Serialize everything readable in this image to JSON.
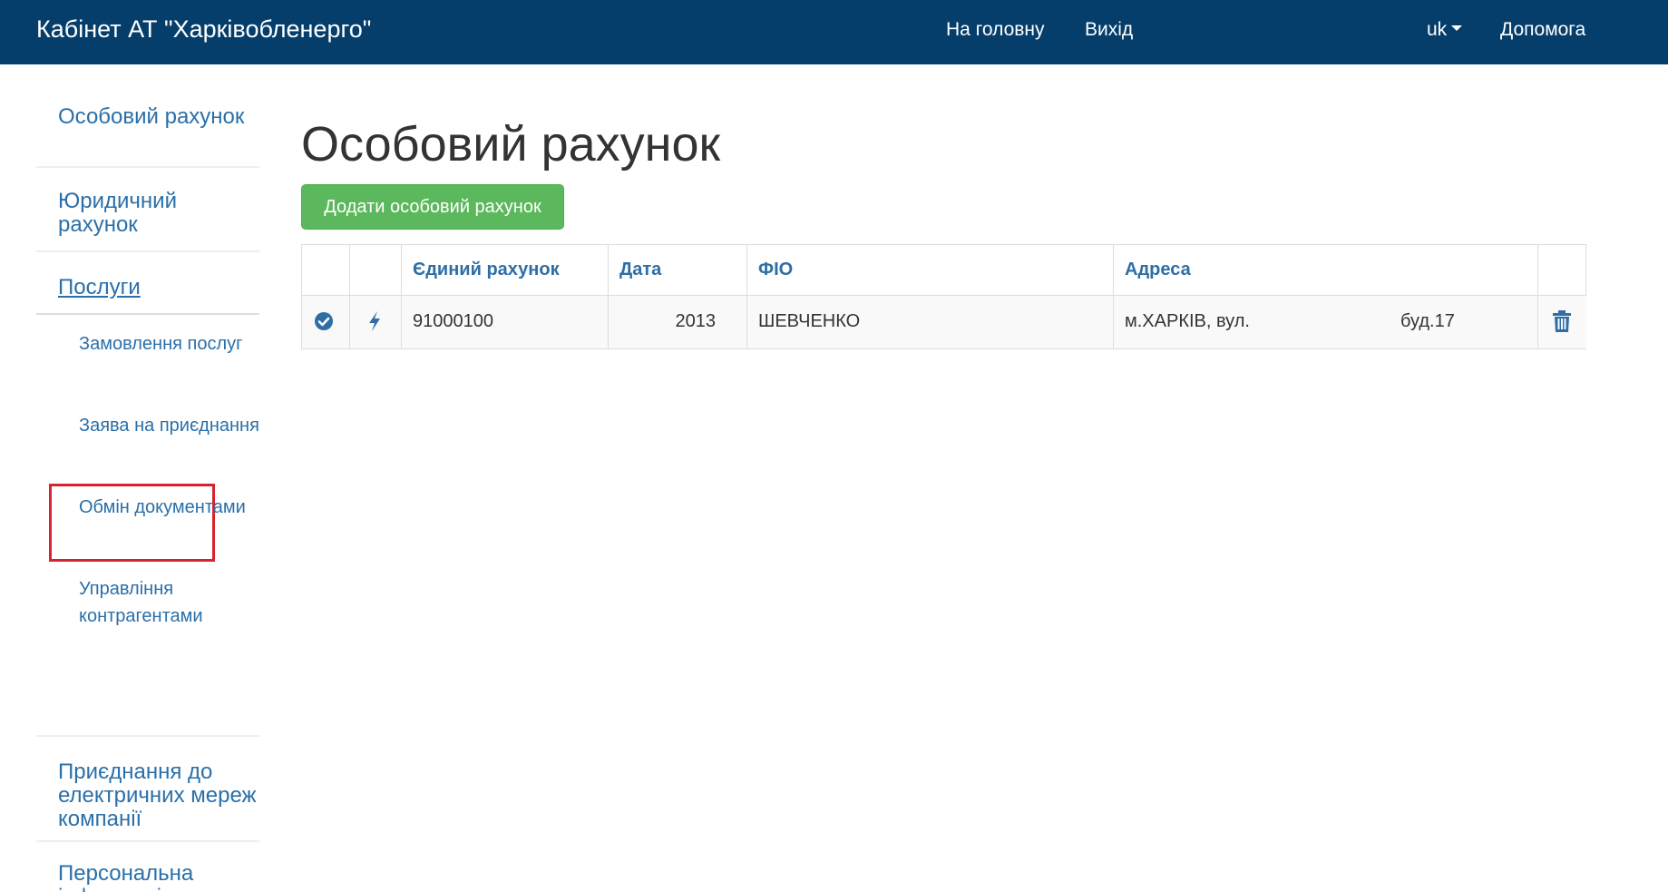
{
  "header": {
    "brand": "Кабінет АТ \"Харківобленерго\"",
    "nav_home": "На головну",
    "nav_exit": "Вихід",
    "lang": "uk",
    "help": "Допомога"
  },
  "sidebar": {
    "personal_account": "Особовий рахунок",
    "legal_account": "Юридичний рахунок",
    "services": "Послуги",
    "sub_items": [
      "Замовлення послуг",
      "Заява на приєднання",
      "Обмін документами",
      "Управління контрагентами"
    ],
    "connection": "Приєднання до електричних мереж компанії",
    "personal_info": "Персональна інформація"
  },
  "main": {
    "title": "Особовий рахунок",
    "add_button": "Додати особовий рахунок",
    "table": {
      "headers": [
        "",
        "",
        "Єдиний рахунок",
        "Дата",
        "ФІО",
        "Адреса",
        ""
      ],
      "rows": [
        {
          "account": "91000100",
          "date": "2013",
          "name": "ШЕВЧЕНКО",
          "address_street": "м.ХАРКІВ, вул.",
          "address_building": "буд.17"
        }
      ]
    }
  },
  "colors": {
    "navbar": "#063e6b",
    "link": "#2a6fa9",
    "success": "#5cb85c",
    "highlight": "#d7232f"
  },
  "icons": {
    "status": "check-circle-icon",
    "action": "lightning-bolt-icon",
    "delete": "trash-icon"
  }
}
